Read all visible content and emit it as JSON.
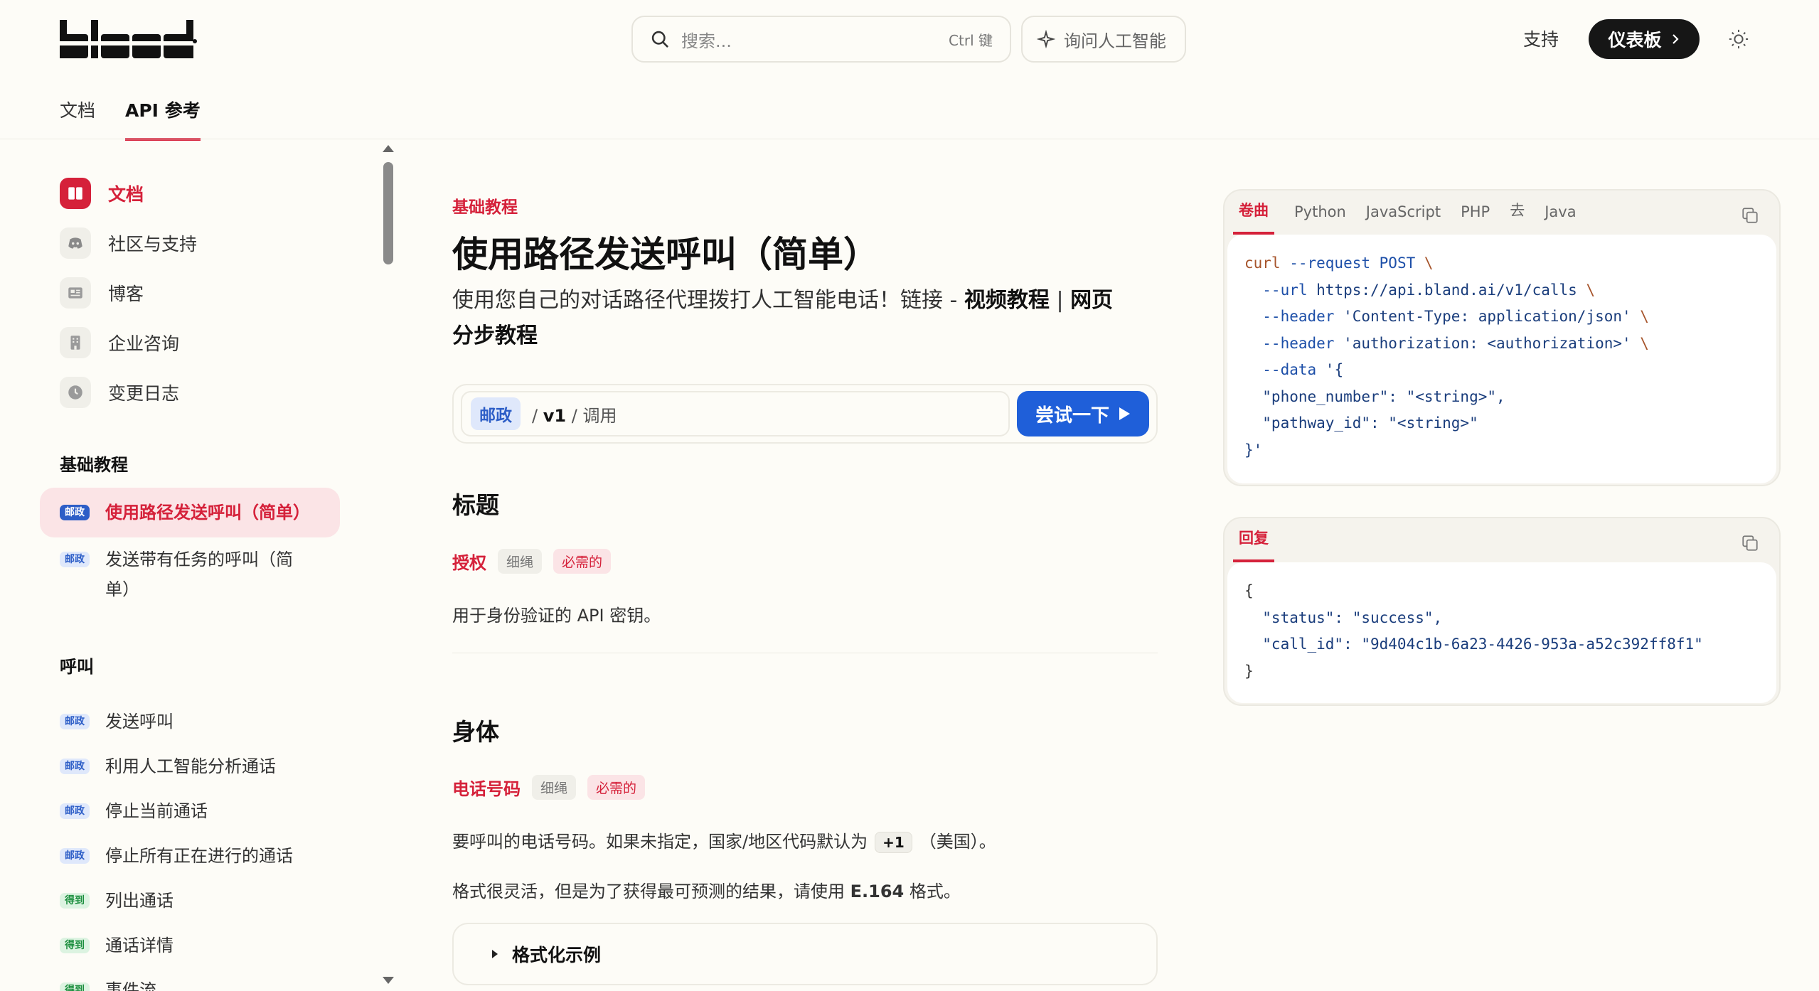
{
  "header": {
    "search_placeholder": "搜索...",
    "search_shortcut": "Ctrl 键",
    "ask_ai": "询问人工智能",
    "support": "支持",
    "dashboard": "仪表板"
  },
  "topnav": {
    "docs": "文档",
    "api": "API 参考"
  },
  "sidebar": {
    "toplinks": [
      {
        "label": "文档",
        "icon": "book-icon"
      },
      {
        "label": "社区与支持",
        "icon": "discord-icon"
      },
      {
        "label": "博客",
        "icon": "newspaper-icon"
      },
      {
        "label": "企业咨询",
        "icon": "building-icon"
      },
      {
        "label": "变更日志",
        "icon": "clock-icon"
      }
    ],
    "basic_heading": "基础教程",
    "basic_items": [
      {
        "method": "邮政",
        "label": "使用路径发送呼叫（简单）"
      },
      {
        "method": "邮政",
        "label_line1": "发送带有任务的呼叫（简",
        "label_line2": "单）"
      }
    ],
    "calls_heading": "呼叫",
    "call_items": [
      {
        "method": "邮政",
        "label": "发送呼叫"
      },
      {
        "method": "邮政",
        "label": "利用人工智能分析通话"
      },
      {
        "method": "邮政",
        "label": "停止当前通话"
      },
      {
        "method": "邮政",
        "label": "停止所有正在进行的通话"
      },
      {
        "method": "得到",
        "label": "列出通话"
      },
      {
        "method": "得到",
        "label": "通话详情"
      },
      {
        "method": "得到",
        "label": "事件流"
      }
    ]
  },
  "main": {
    "breadcrumb": "基础教程",
    "title": "使用路径发送呼叫（简单）",
    "desc_prefix": "使用您自己的对话路径代理拨打人工智能电话！链接 - ",
    "desc_link1": "视频教程",
    "desc_sep": " | ",
    "desc_link2": "网页",
    "desc_link3": "分步教程",
    "endpoint": {
      "method": "邮政",
      "path_sep": "/",
      "version": "v1",
      "path_sep2": "/",
      "resource": "调用",
      "try": "尝试一下"
    },
    "headers_title": "标题",
    "auth": {
      "name": "授权",
      "type": "细绳",
      "required": "必需的",
      "desc": "用于身份验证的 API 密钥。"
    },
    "body_title": "身体",
    "phone": {
      "name": "电话号码",
      "type": "细绳",
      "required": "必需的",
      "desc_a": "要呼叫的电话号码。如果未指定，国家/地区代码默认为",
      "code": "+1",
      "desc_b": "（美国）。",
      "desc2_a": "格式很灵活，但是为了获得最可预测的结果，请使用 ",
      "desc2_b": "E.164",
      "desc2_c": " 格式。"
    },
    "expander": "格式化示例"
  },
  "request_panel": {
    "tabs": [
      "卷曲",
      "Python",
      "JavaScript",
      "PHP",
      "去",
      "Java"
    ],
    "code": {
      "l1a": "curl",
      "l1b": " --request POST ",
      "l1c": "\\",
      "l2a": "  --url ",
      "l2b": "https://api.bland.ai/v1/calls",
      "l2c": " \\",
      "l3a": "  --header ",
      "l3b": "'Content-Type: application/json'",
      "l3c": " \\",
      "l4a": "  --header ",
      "l4b": "'authorization: <authorization>'",
      "l4c": " \\",
      "l5a": "  --data ",
      "l5b": "'{",
      "l6": "  \"phone_number\": \"<string>\",",
      "l7": "  \"pathway_id\": \"<string>\"",
      "l8": "}'"
    }
  },
  "response_panel": {
    "tab": "回复",
    "code": {
      "l1": "{",
      "l2": "  \"status\": \"success\",",
      "l3": "  \"call_id\": \"9d404c1b-6a23-4426-953a-a52c392ff8f1\"",
      "l4": "}"
    }
  }
}
